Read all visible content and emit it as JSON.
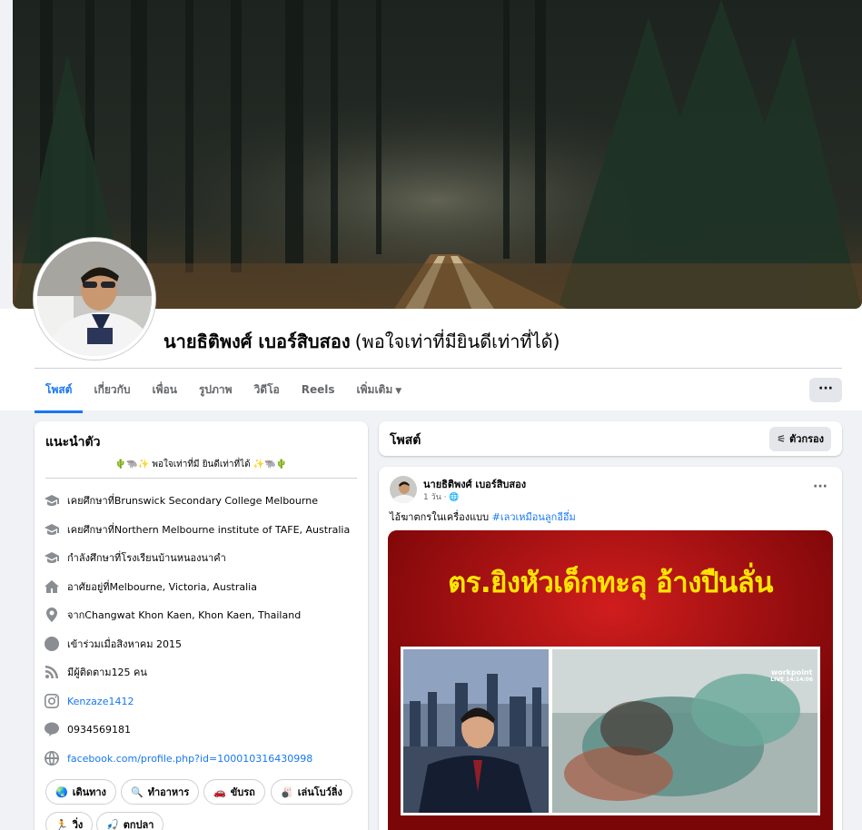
{
  "profile": {
    "name": "นายธิติพงศ์ เบอร์สิบสอง",
    "nickname": "(พอใจเท่าที่มียินดีเท่าที่ได้)"
  },
  "tabs": [
    {
      "label": "โพสต์",
      "active": true
    },
    {
      "label": "เกี่ยวกับ"
    },
    {
      "label": "เพื่อน"
    },
    {
      "label": "รูปภาพ"
    },
    {
      "label": "วิดีโอ"
    },
    {
      "label": "Reels"
    },
    {
      "label": "เพิ่มเติม"
    }
  ],
  "more_button": "···",
  "intro": {
    "title": "แนะนำตัว",
    "bio": "🌵🐃✨ พอใจเท่าที่มี ยินดีเท่าที่ได้ ✨🐃🌵",
    "rows": [
      {
        "icon": "graduation-cap-icon",
        "label": "เคยศึกษาที่ ",
        "value": "Brunswick Secondary College Melbourne"
      },
      {
        "icon": "graduation-cap-icon",
        "label": "เคยศึกษาที่ ",
        "value": "Northern Melbourne institute of TAFE, Australia"
      },
      {
        "icon": "graduation-cap-icon",
        "label": "กำลังศึกษาที่ ",
        "value": "โรงเรียนบ้านหนองนาคำ"
      },
      {
        "icon": "home-icon",
        "label": "อาศัยอยู่ที่ ",
        "value": "Melbourne, Victoria, Australia"
      },
      {
        "icon": "location-pin-icon",
        "label": "จาก ",
        "value": "Changwat Khon Kaen, Khon Kaen, Thailand"
      },
      {
        "icon": "clock-icon",
        "label": "เข้าร่วมเมื่อ ",
        "value": "สิงหาคม 2015"
      },
      {
        "icon": "rss-icon",
        "label": "มีผู้ติดตาม ",
        "value": "125 คน"
      },
      {
        "icon": "instagram-icon",
        "label": "",
        "value": "Kenzaze1412"
      },
      {
        "icon": "line-icon",
        "label": "",
        "value": "0934569181"
      },
      {
        "icon": "globe-icon",
        "label": "",
        "value": "facebook.com/profile.php?id=100010316430998"
      }
    ],
    "hobbies": [
      {
        "emoji": "🌏",
        "label": "เดินทาง"
      },
      {
        "emoji": "🔍",
        "label": "ทำอาหาร"
      },
      {
        "emoji": "🚗",
        "label": "ขับรถ"
      },
      {
        "emoji": "🎳",
        "label": "เล่นโบว์ลิ่ง"
      },
      {
        "emoji": "🏃",
        "label": "วิ่ง"
      },
      {
        "emoji": "🎣",
        "label": "ตกปลา"
      }
    ]
  },
  "posts": {
    "title": "โพสต์",
    "filter_label": "ตัวกรอง"
  },
  "post": {
    "author": "นายธิติพงศ์ เบอร์สิบสอง",
    "meta": "1 วัน · ",
    "text": "ไอ้ฆาตกรในเครื่องแบบ ",
    "hashtag": "#เลวเหมือนลูกอีอึ่ม",
    "image_headline": "ตร.ยิงหัวเด็กทะลุ อ้างปืนลั่น",
    "watermark": "workpoint",
    "watermark_live": "LIVE 14:14:06"
  }
}
